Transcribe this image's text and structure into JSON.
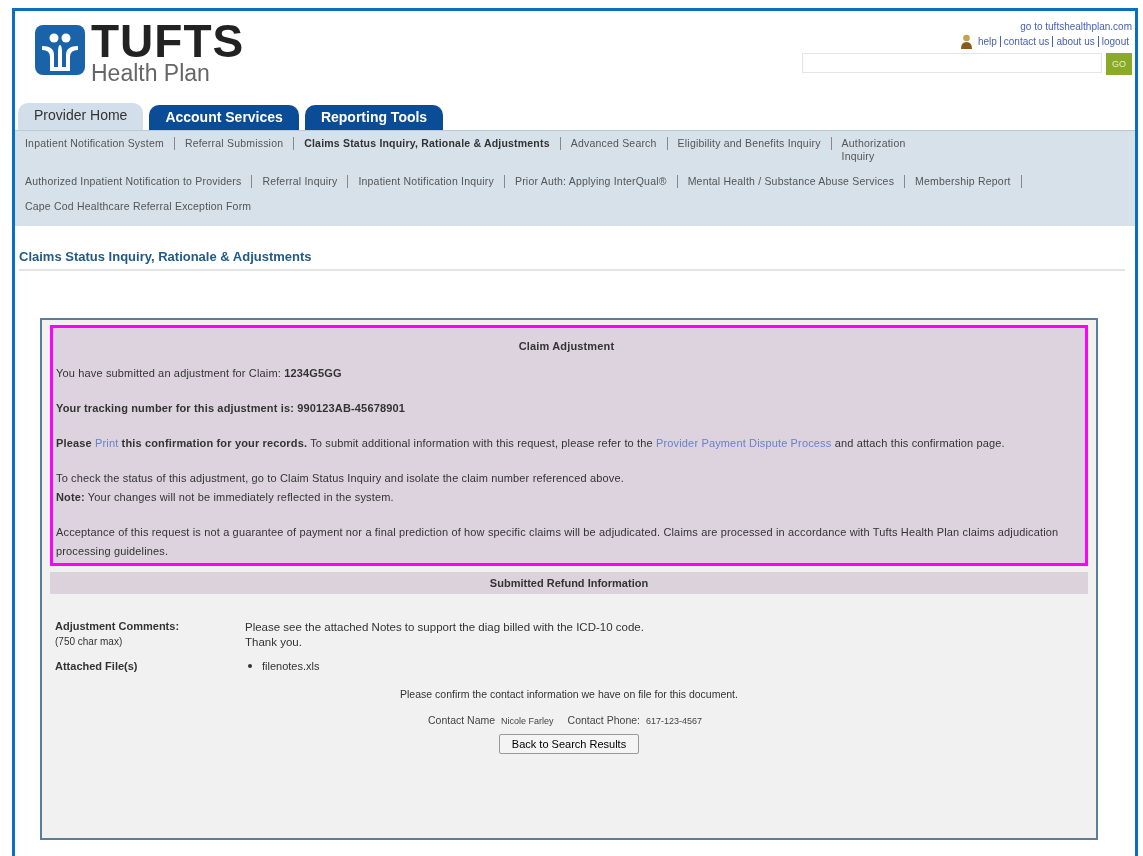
{
  "header": {
    "logo": {
      "name": "TUFTS",
      "subtitle": "Health Plan"
    },
    "site_link": "go to tuftshealthplan.com",
    "utility_links": [
      "help",
      "contact us",
      "about us",
      "logout"
    ],
    "search": {
      "button": "GO"
    }
  },
  "tabs": [
    {
      "label": "Provider Home",
      "selected": true
    },
    {
      "label": "Account Services",
      "selected": false
    },
    {
      "label": "Reporting Tools",
      "selected": false
    }
  ],
  "subnav": [
    {
      "label": "Inpatient Notification System",
      "selected": false
    },
    {
      "label": "Referral Submission",
      "selected": false
    },
    {
      "label": "Claims Status Inquiry, Rationale & Adjustments",
      "selected": true
    },
    {
      "label": "Advanced Search",
      "selected": false
    },
    {
      "label": "Eligibility and Benefits Inquiry",
      "selected": false
    },
    {
      "label": "Authorization Inquiry",
      "selected": false
    },
    {
      "label": "Authorized Inpatient Notification to Providers",
      "selected": false
    },
    {
      "label": "Referral Inquiry",
      "selected": false
    },
    {
      "label": "Inpatient Notification Inquiry",
      "selected": false
    },
    {
      "label": "Prior Auth: Applying InterQual®",
      "selected": false
    },
    {
      "label": "Mental Health / Substance Abuse Services",
      "selected": false
    },
    {
      "label": "Membership Report",
      "selected": false
    },
    {
      "label": "Cape Cod Healthcare Referral Exception Form",
      "selected": false
    }
  ],
  "page_title": "Claims Status Inquiry, Rationale & Adjustments",
  "confirmation": {
    "title": "Claim Adjustment",
    "paragraphs": [
      {
        "kind": "para",
        "bold": false,
        "text": "You have submitted an adjustment for Claim:  **1234G5GG**"
      },
      {
        "kind": "para",
        "bold": true,
        "text": "Your tracking number for this adjustment is:  990123AB-45678901"
      },
      {
        "kind": "para",
        "bold": false,
        "segments": [
          {
            "kind": "text",
            "text": "**Please**"
          },
          {
            "kind": "link",
            "text": "Print"
          },
          {
            "kind": "text",
            "text": "**this confirmation for your records.** To submit additional information with this request, please refer to the"
          },
          {
            "kind": "link",
            "text": "Provider Payment Dispute Process"
          },
          {
            "kind": "text",
            "text": "and attach this confirmation page."
          }
        ]
      },
      {
        "kind": "para",
        "bold": false,
        "text": "To check the status of this adjustment, go to Claim Status Inquiry and isolate the claim number referenced above."
      },
      {
        "kind": "line",
        "bold": false,
        "text": "**Note:** Your changes will not be immediately reflected in the system."
      },
      {
        "kind": "para",
        "bold": false,
        "text": "Acceptance of this request is not a guarantee of payment nor a final prediction of how specific claims will be adjudicated. Claims are processed in accordance with Tufts Health Plan claims adjudication processing guidelines."
      }
    ]
  },
  "refund": {
    "title": "Submitted Refund Information",
    "fields": [
      {
        "label": "Adjustment Comments:",
        "hint": "(750 char max)",
        "value": "Please see the attached Notes to support the diag billed with the ICD-10 code.\nThank you."
      },
      {
        "label": "Attached File(s)",
        "files": [
          "filenotes.xls"
        ]
      }
    ],
    "confirm_text": "Please confirm the contact information we have on file for this document.",
    "contact": [
      {
        "label": "Contact Name",
        "value": "Nicole Farley"
      },
      {
        "label": "Contact Phone:",
        "value": "617-123-4567"
      }
    ],
    "button": "Back to Search Results"
  }
}
